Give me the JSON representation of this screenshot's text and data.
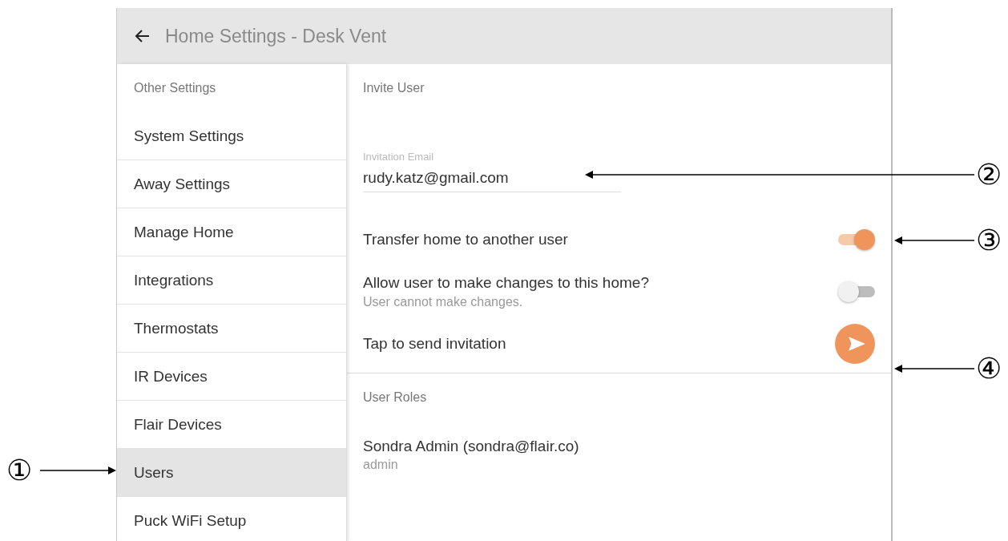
{
  "header": {
    "title": "Home Settings - Desk Vent"
  },
  "sidebar": {
    "heading": "Other Settings",
    "items": [
      {
        "label": "System Settings",
        "selected": false
      },
      {
        "label": "Away Settings",
        "selected": false
      },
      {
        "label": "Manage Home",
        "selected": false
      },
      {
        "label": "Integrations",
        "selected": false
      },
      {
        "label": "Thermostats",
        "selected": false
      },
      {
        "label": "IR Devices",
        "selected": false
      },
      {
        "label": "Flair Devices",
        "selected": false
      },
      {
        "label": "Users",
        "selected": true
      },
      {
        "label": "Puck WiFi Setup",
        "selected": false
      }
    ]
  },
  "invite": {
    "heading": "Invite User",
    "email_label": "Invitation Email",
    "email_value": "rudy.katz@gmail.com",
    "rows": [
      {
        "kind": "toggle",
        "label": "Transfer home to another user",
        "on": true
      },
      {
        "kind": "toggle",
        "label": "Allow user to make changes to this home?",
        "sublabel": "User cannot make changes.",
        "on": false
      },
      {
        "kind": "action",
        "label": "Tap to send invitation"
      }
    ]
  },
  "roles": {
    "heading": "User Roles",
    "users": [
      {
        "name": "Sondra Admin (sondra@flair.co)",
        "role": "admin"
      }
    ]
  },
  "callouts": [
    {
      "label": "①"
    },
    {
      "label": "②"
    },
    {
      "label": "③"
    },
    {
      "label": "④"
    }
  ]
}
